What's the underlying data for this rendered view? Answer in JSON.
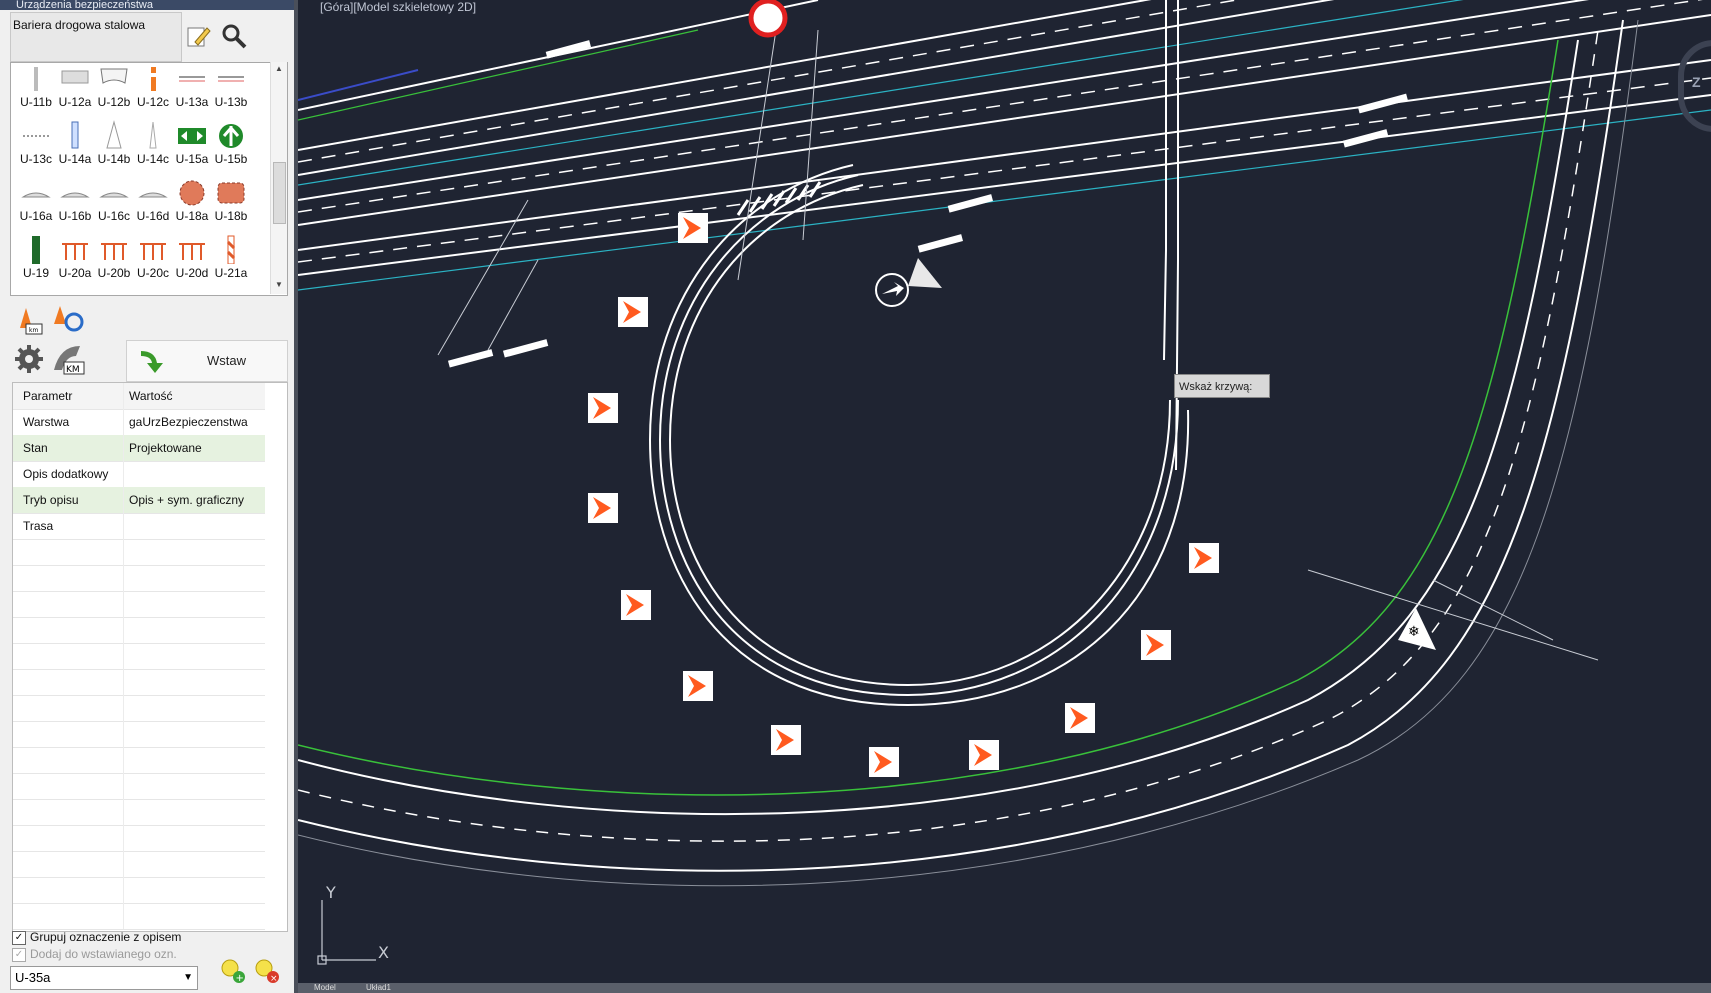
{
  "panel": {
    "title": "Urządzenia bezpieczeństwa",
    "category": "Bariera drogowa stalowa",
    "symbols": [
      {
        "label": "U-11b",
        "icon": "post-icon"
      },
      {
        "label": "U-12a",
        "icon": "barrier-plate-icon"
      },
      {
        "label": "U-12b",
        "icon": "barrier-curve-icon"
      },
      {
        "label": "U-12c",
        "icon": "orange-post-icon"
      },
      {
        "label": "U-13a",
        "icon": "rail-icon"
      },
      {
        "label": "U-13b",
        "icon": "rail-icon"
      },
      {
        "label": "U-13c",
        "icon": "dotted-rail-icon"
      },
      {
        "label": "U-14a",
        "icon": "blue-post-icon"
      },
      {
        "label": "U-14b",
        "icon": "cone-outline-icon"
      },
      {
        "label": "U-14c",
        "icon": "thin-post-icon"
      },
      {
        "label": "U-15a",
        "icon": "green-double-arrow-icon"
      },
      {
        "label": "U-15b",
        "icon": "green-split-icon"
      },
      {
        "label": "U-16a",
        "icon": "hump-icon"
      },
      {
        "label": "U-16b",
        "icon": "hump-icon"
      },
      {
        "label": "U-16c",
        "icon": "hump-icon"
      },
      {
        "label": "U-16d",
        "icon": "hump-icon"
      },
      {
        "label": "U-18a",
        "icon": "gear-block-icon"
      },
      {
        "label": "U-18b",
        "icon": "block-icon"
      },
      {
        "label": "U-19",
        "icon": "green-pole-icon"
      },
      {
        "label": "U-20a",
        "icon": "fence-icon"
      },
      {
        "label": "U-20b",
        "icon": "fence-icon"
      },
      {
        "label": "U-20c",
        "icon": "fence-icon"
      },
      {
        "label": "U-20d",
        "icon": "fence-icon"
      },
      {
        "label": "U-21a",
        "icon": "striped-post-icon"
      }
    ],
    "insert_label": "Wstaw",
    "grid": {
      "headers": [
        "Parametr",
        "Wartość"
      ],
      "rows": [
        {
          "param": "Warstwa",
          "value": "gaUrzBezpieczenstwa"
        },
        {
          "param": "Stan",
          "value": "Projektowane"
        },
        {
          "param": "Opis dodatkowy",
          "value": ""
        },
        {
          "param": "Tryb opisu",
          "value": "Opis + sym. graficzny"
        },
        {
          "param": "Trasa",
          "value": ""
        }
      ]
    },
    "group_label": "Grupuj oznaczenie z opisem",
    "add_label": "Dodaj do wstawianego ozn.",
    "combo_value": "U-35a"
  },
  "canvas": {
    "viewport_label": "[Góra][Model szkieletowy 2D]",
    "tooltip": "Wskaż krzywą:",
    "navwheel_letter": "Z",
    "tabs": [
      "Model",
      "Układ1"
    ]
  },
  "colors": {
    "background": "#1f2432",
    "road_line": "#ffffff",
    "green_line": "#39c13a",
    "cyan_line": "#2bb3c4",
    "chevron": "#ff5a1f"
  }
}
